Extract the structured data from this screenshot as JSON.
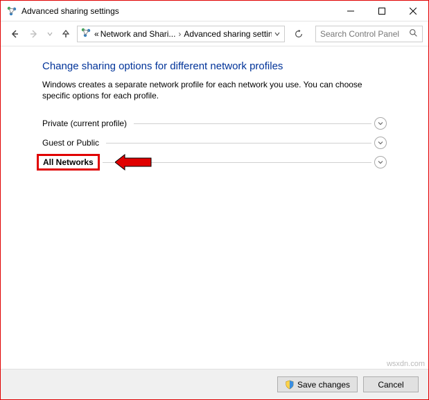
{
  "window": {
    "title": "Advanced sharing settings"
  },
  "breadcrumb": {
    "prefix": "«",
    "item1": "Network and Shari...",
    "item2": "Advanced sharing settings"
  },
  "search": {
    "placeholder": "Search Control Panel"
  },
  "page": {
    "heading": "Change sharing options for different network profiles",
    "description": "Windows creates a separate network profile for each network you use. You can choose specific options for each profile."
  },
  "sections": {
    "private": "Private (current profile)",
    "guest": "Guest or Public",
    "all": "All Networks"
  },
  "footer": {
    "save": "Save changes",
    "cancel": "Cancel"
  },
  "watermark": "wsxdn.com"
}
